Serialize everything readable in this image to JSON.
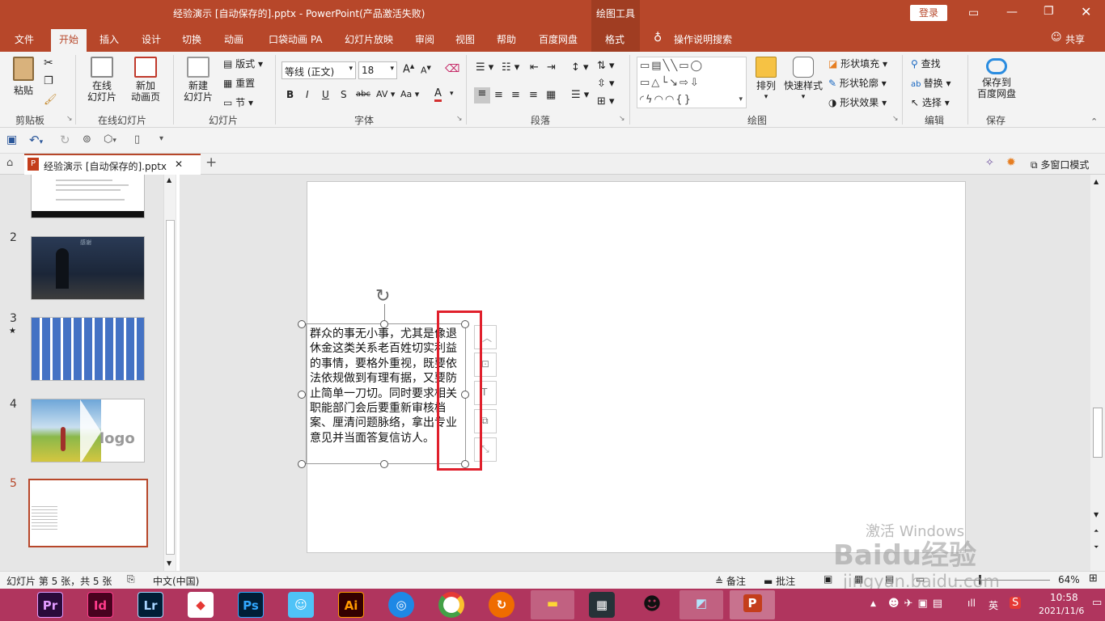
{
  "title_bar": {
    "title": "经验演示 [自动保存的].pptx  -  PowerPoint(产品激活失败)",
    "context_tab": "绘图工具",
    "login": "登录"
  },
  "tabs": [
    "文件",
    "开始",
    "插入",
    "设计",
    "切换",
    "动画",
    "口袋动画 PA",
    "幻灯片放映",
    "审阅",
    "视图",
    "帮助",
    "百度网盘",
    "格式"
  ],
  "tell_me": "操作说明搜索",
  "share": "共享",
  "ribbon": {
    "clipboard": {
      "paste": "粘贴",
      "label": "剪贴板"
    },
    "online": {
      "online_slide": "在线\n幻灯片",
      "new_anim": "新加\n动画页",
      "label": "在线幻灯片"
    },
    "slides": {
      "new_slide": "新建\n幻灯片",
      "layout": "版式",
      "reset": "重置",
      "section": "节",
      "label": "幻灯片"
    },
    "font": {
      "font_name": "等线 (正文)",
      "font_size": "18",
      "label": "字体"
    },
    "paragraph": {
      "label": "段落"
    },
    "drawing": {
      "arrange": "排列",
      "quick_style": "快速样式",
      "fill": "形状填充",
      "outline": "形状轮廓",
      "effect": "形状效果",
      "label": "绘图"
    },
    "editing": {
      "find": "查找",
      "replace": "替换",
      "select": "选择",
      "label": "编辑"
    },
    "save": {
      "save_to": "保存到\n百度网盘",
      "label": "保存"
    }
  },
  "doc_tab": {
    "name": "经验演示 [自动保存的].pptx",
    "multi_window": "多窗口模式"
  },
  "thumbnails": [
    {
      "num": "2"
    },
    {
      "num": "3",
      "mark": "★"
    },
    {
      "num": "4",
      "logo": "logo"
    },
    {
      "num": "5"
    }
  ],
  "slide2_title": "感谢",
  "textbox": {
    "text": "群众的事无小事，尤其是像退休金这类关系老百姓切实利益的事情，要格外重视，既要依法依规做到有理有据，又要防止简单一刀切。同时要求相关职能部门会后要重新审核档案、厘清问题脉络，拿出专业意见并当面答复信访人。"
  },
  "watermark": {
    "activate": "激活 Windows",
    "baidu": "Baidu经验",
    "url": "jingyan.baidu.com"
  },
  "status": {
    "slide_info": "幻灯片 第 5 张，共 5 张",
    "language": "中文(中国)",
    "notes": "备注",
    "comments": "批注",
    "zoom": "64%"
  },
  "taskbar": {
    "apps": [
      "Pr",
      "Id",
      "Lr",
      "Ps",
      "Ai"
    ],
    "ime": "英",
    "time": "10:58",
    "date": "2021/11/6"
  },
  "colors": {
    "accent": "#b7472a",
    "taskbar": "#b0355e",
    "selection_box": "#e0202c"
  }
}
